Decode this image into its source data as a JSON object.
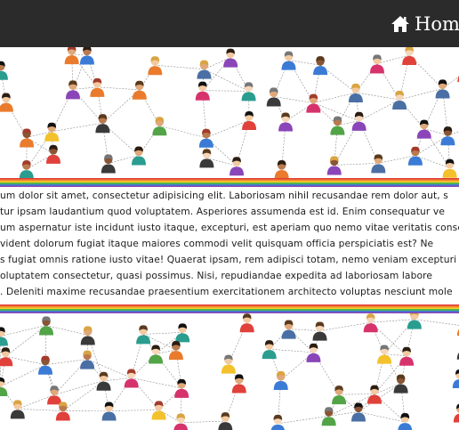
{
  "header": {
    "home_label": "Home"
  },
  "content": {
    "lines": [
      "um dolor sit amet, consectetur adipisicing elit. Laboriosam nihil recusandae rem dolor aut, s",
      "tur ipsam laudantium quod voluptatem. Asperiores assumenda est id. Enim consequatur ve",
      "um aspernatur iste incidunt iusto itaque, excepturi, est aperiam quo nemo vitae veritatis conse",
      "vident dolorum fugiat itaque maiores commodi velit quisquam officia perspiciatis est? Ne",
      "s fugiat omnis ratione iusto vitae! Quaerat ipsam, rem adipisci totam, nemo veniam excepturi q",
      "oluptatem consectetur, quasi possimus. Nisi, repudiandae expedita ad laboriosam labore",
      ". Deleniti maxime recusandae praesentium exercitationem architecto voluptas nesciunt mole"
    ]
  },
  "colors": {
    "header_bg": "#2b2b2b",
    "header_text": "#ffffff",
    "body_text": "#1c1c1c",
    "rainbow": [
      "#e23b3b",
      "#f08a2a",
      "#f6d12c",
      "#52b44c",
      "#3b7bd6",
      "#8a46b8"
    ]
  },
  "icons": {
    "home": "house-icon"
  },
  "images": {
    "top": "people-network-illustration",
    "bottom": "people-network-illustration"
  }
}
